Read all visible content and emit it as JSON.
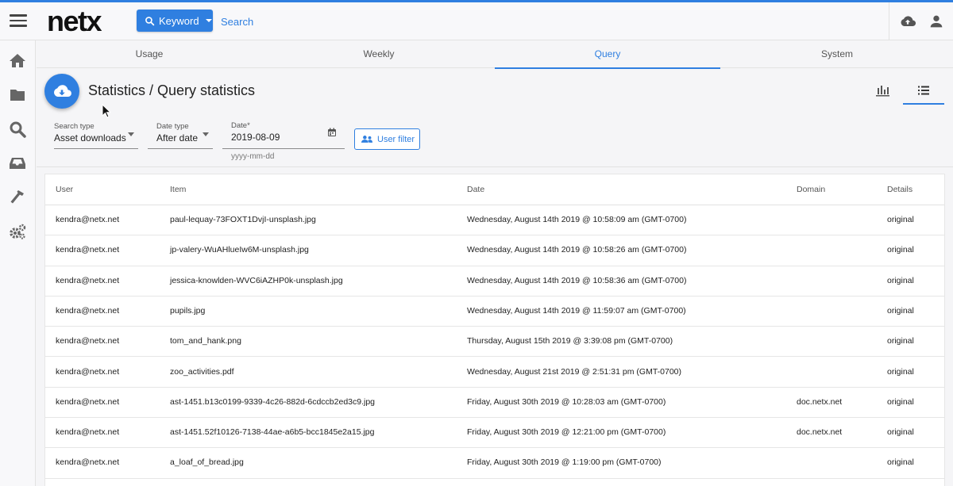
{
  "app": {
    "logo": "netx"
  },
  "header": {
    "search_mode_label": "Keyword",
    "search_placeholder": "Search"
  },
  "tabs": [
    {
      "label": "Usage"
    },
    {
      "label": "Weekly"
    },
    {
      "label": "Query",
      "active": true
    },
    {
      "label": "System"
    }
  ],
  "page": {
    "title": "Statistics / Query statistics"
  },
  "filters": {
    "search_type": {
      "label": "Search type",
      "value": "Asset downloads"
    },
    "date_type": {
      "label": "Date type",
      "value": "After date"
    },
    "date": {
      "label": "Date*",
      "value": "2019-08-09",
      "hint": "yyyy-mm-dd"
    },
    "user_filter_label": "User filter"
  },
  "table": {
    "columns": [
      "User",
      "Item",
      "Date",
      "Domain",
      "Details"
    ],
    "rows": [
      {
        "user": "kendra@netx.net",
        "item": "paul-lequay-73FOXT1DvjI-unsplash.jpg",
        "date": "Wednesday, August 14th 2019 @ 10:58:09 am (GMT-0700)",
        "domain": "",
        "details": "original"
      },
      {
        "user": "kendra@netx.net",
        "item": "jp-valery-WuAHlueIw6M-unsplash.jpg",
        "date": "Wednesday, August 14th 2019 @ 10:58:26 am (GMT-0700)",
        "domain": "",
        "details": "original"
      },
      {
        "user": "kendra@netx.net",
        "item": "jessica-knowlden-WVC6iAZHP0k-unsplash.jpg",
        "date": "Wednesday, August 14th 2019 @ 10:58:36 am (GMT-0700)",
        "domain": "",
        "details": "original"
      },
      {
        "user": "kendra@netx.net",
        "item": "pupils.jpg",
        "date": "Wednesday, August 14th 2019 @ 11:59:07 am (GMT-0700)",
        "domain": "",
        "details": "original"
      },
      {
        "user": "kendra@netx.net",
        "item": "tom_and_hank.png",
        "date": "Thursday, August 15th 2019 @ 3:39:08 pm (GMT-0700)",
        "domain": "",
        "details": "original"
      },
      {
        "user": "kendra@netx.net",
        "item": "zoo_activities.pdf",
        "date": "Wednesday, August 21st 2019 @ 2:51:31 pm (GMT-0700)",
        "domain": "",
        "details": "original"
      },
      {
        "user": "kendra@netx.net",
        "item": "ast-1451.b13c0199-9339-4c26-882d-6cdccb2ed3c9.jpg",
        "date": "Friday, August 30th 2019 @ 10:28:03 am (GMT-0700)",
        "domain": "doc.netx.net",
        "details": "original"
      },
      {
        "user": "kendra@netx.net",
        "item": "ast-1451.52f10126-7138-44ae-a6b5-bcc1845e2a15.jpg",
        "date": "Friday, August 30th 2019 @ 12:21:00 pm (GMT-0700)",
        "domain": "doc.netx.net",
        "details": "original"
      },
      {
        "user": "kendra@netx.net",
        "item": "a_loaf_of_bread.jpg",
        "date": "Friday, August 30th 2019 @ 1:19:00 pm (GMT-0700)",
        "domain": "",
        "details": "original"
      }
    ]
  },
  "icons": {
    "menu": "hamburger-menu-icon",
    "upload": "cloud-upload-icon",
    "user": "user-icon",
    "sidebar": [
      "home-icon",
      "folder-icon",
      "search-icon",
      "inbox-icon",
      "hammer-icon",
      "cogs-icon"
    ],
    "fab": "cloud-download-icon",
    "view_chart": "bar-chart-icon",
    "view_list": "list-icon"
  },
  "colors": {
    "accent": "#2f7fe0"
  }
}
